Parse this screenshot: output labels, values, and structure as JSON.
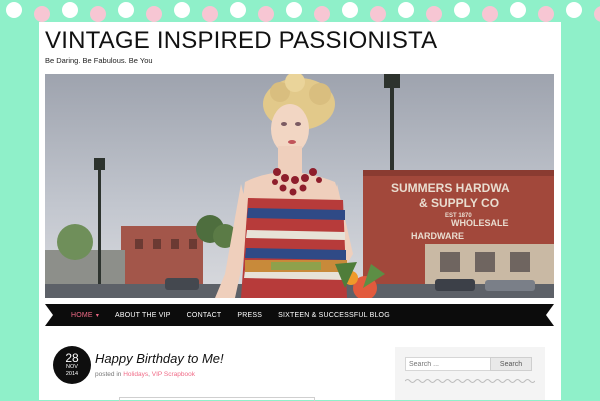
{
  "site": {
    "title": "VINTAGE INSPIRED PASSIONISTA",
    "tagline": "Be Daring. Be Fabulous. Be You"
  },
  "header_image": {
    "alt": "Woman in patterned strapless dress holding flowers",
    "sign_lines": [
      "SUMMERS HARDWA",
      "& SUPPLY CO",
      "EST 1870",
      "WHOLESALE",
      "HARDWARE"
    ]
  },
  "nav": {
    "items": [
      {
        "label": "HOME",
        "active": true,
        "has_submenu": true
      },
      {
        "label": "ABOUT THE VIP",
        "active": false,
        "has_submenu": false
      },
      {
        "label": "CONTACT",
        "active": false,
        "has_submenu": false
      },
      {
        "label": "PRESS",
        "active": false,
        "has_submenu": false
      },
      {
        "label": "SIXTEEN & SUCCESSFUL BLOG",
        "active": false,
        "has_submenu": false
      }
    ]
  },
  "post": {
    "date": {
      "day": "28",
      "month": "NOV",
      "year": "2014"
    },
    "title": "Happy Birthday to Me!",
    "meta_prefix": "posted in",
    "categories": [
      "Holidays",
      "VIP Scrapbook"
    ],
    "category_separator": ", "
  },
  "sidebar": {
    "search": {
      "placeholder": "Search ...",
      "button_label": "Search"
    }
  },
  "colors": {
    "background": "#8ff0c9",
    "accent": "#f06a86",
    "dot_colors": [
      "#ffffff",
      "#f7c6d3"
    ]
  }
}
